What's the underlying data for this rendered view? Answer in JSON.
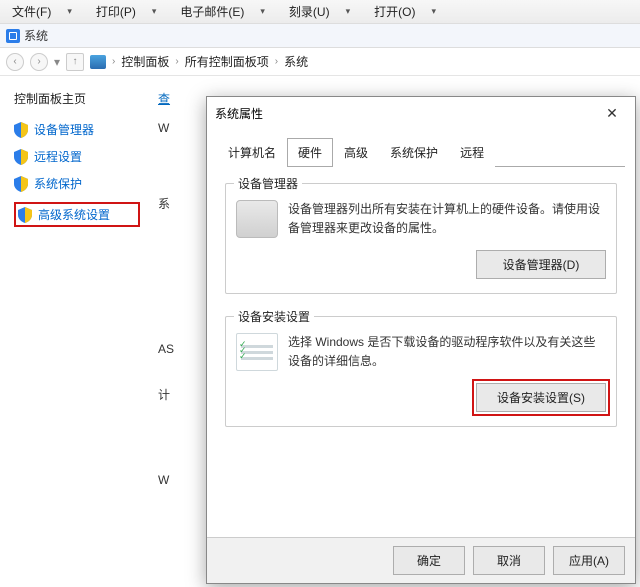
{
  "menubar": {
    "file": "文件(F)",
    "print": "打印(P)",
    "email": "电子邮件(E)",
    "burn": "刻录(U)",
    "open": "打开(O)"
  },
  "pathbar": {
    "label": "系统"
  },
  "breadcrumb": {
    "cp": "控制面板",
    "all": "所有控制面板项",
    "sys": "系统"
  },
  "sidebar": {
    "home": "控制面板主页",
    "items": [
      {
        "label": "设备管理器"
      },
      {
        "label": "远程设置"
      },
      {
        "label": "系统保护"
      },
      {
        "label": "高级系统设置"
      }
    ]
  },
  "content": {
    "headlink": "查",
    "row_w": "W",
    "row_sys": "系",
    "row_as": "AS",
    "row_calc": "计",
    "row_w2": "W"
  },
  "dialog": {
    "title": "系统属性",
    "tabs": {
      "computer": "计算机名",
      "hardware": "硬件",
      "advanced": "高级",
      "protect": "系统保护",
      "remote": "远程"
    },
    "devmgr": {
      "legend": "设备管理器",
      "desc": "设备管理器列出所有安装在计算机上的硬件设备。请使用设备管理器来更改设备的属性。",
      "button": "设备管理器(D)"
    },
    "install": {
      "legend": "设备安装设置",
      "desc": "选择 Windows 是否下载设备的驱动程序软件以及有关这些设备的详细信息。",
      "button": "设备安装设置(S)"
    },
    "footer": {
      "ok": "确定",
      "cancel": "取消",
      "apply": "应用(A)"
    }
  }
}
